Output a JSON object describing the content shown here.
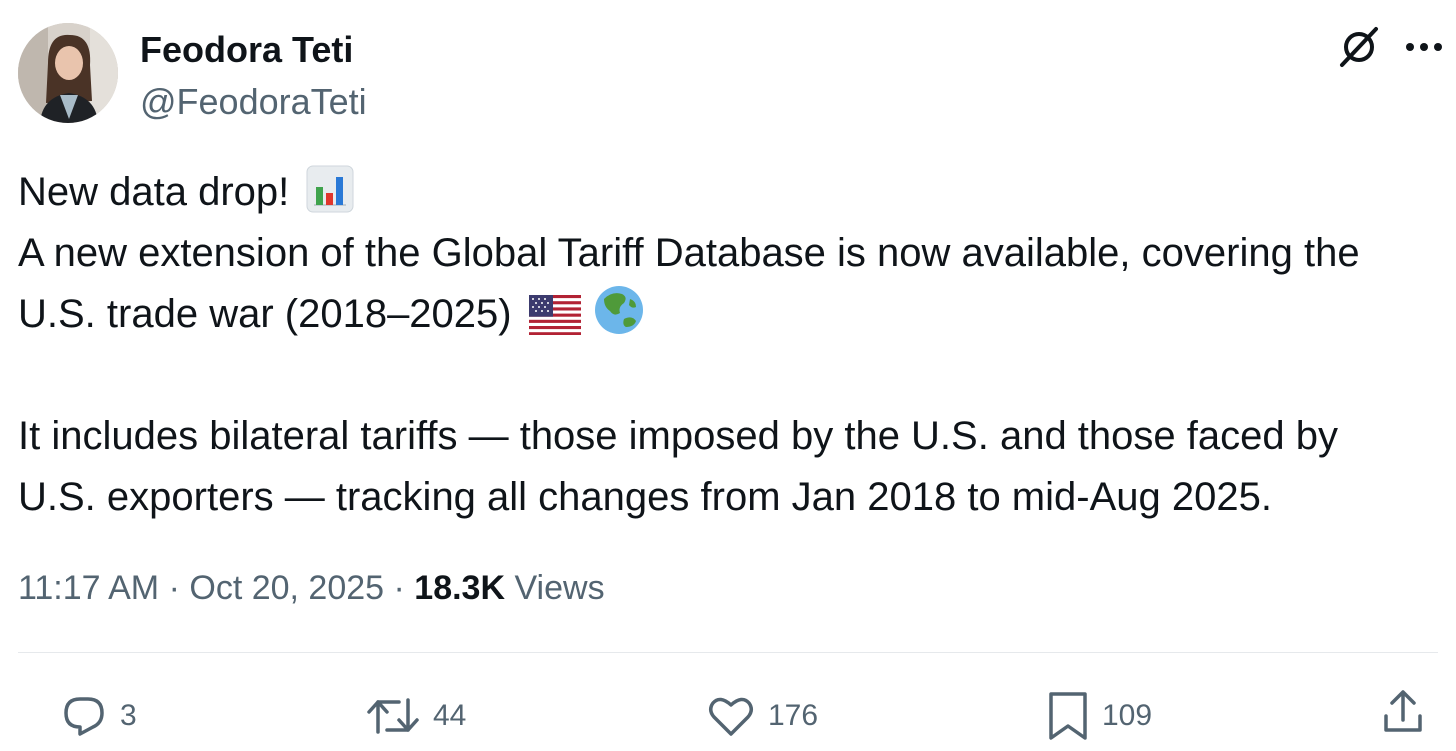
{
  "author": {
    "name": "Feodora Teti",
    "handle": "@FeodoraTeti"
  },
  "icons": {
    "grok": "grok-slash-icon",
    "more": "more-dots-icon",
    "chart_emoji": "bar-chart-emoji",
    "us_flag": "us-flag-emoji",
    "globe": "globe-asia-australia-emoji"
  },
  "post": {
    "line1": "New data drop!",
    "line2": "A new extension of the Global Tariff Database is now available, covering the",
    "line3": "U.S. trade war (2018–2025)",
    "line4": "It includes bilateral tariffs — those imposed by the U.S. and those faced by",
    "line5": "U.S. exporters — tracking all changes from Jan 2018 to mid-Aug 2025."
  },
  "meta": {
    "time": "11:17 AM",
    "separator1": "·",
    "date": "Oct 20, 2025",
    "separator2": "·",
    "views_count": "18.3K",
    "views_label": "Views"
  },
  "actions": {
    "replies": "3",
    "reposts": "44",
    "likes": "176",
    "bookmarks": "109"
  },
  "colors": {
    "text": "#0f1419",
    "secondary": "#536471",
    "divider": "#e6e9ec"
  }
}
